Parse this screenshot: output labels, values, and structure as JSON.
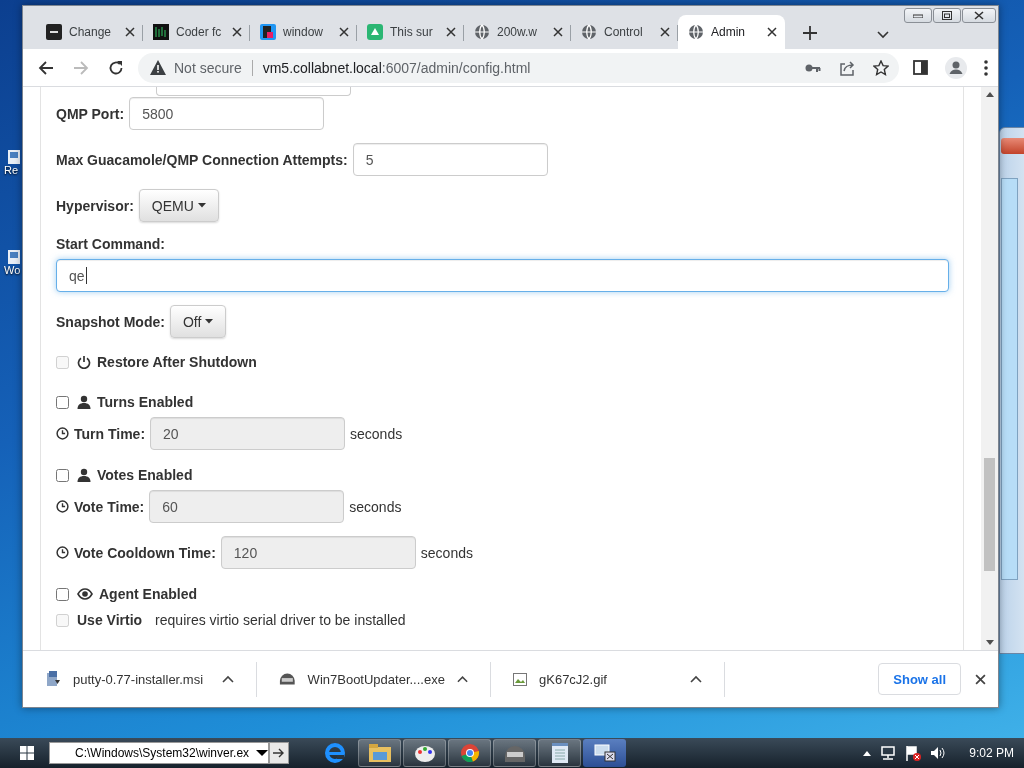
{
  "desktop": {
    "icon_labels": [
      "Re",
      "Wo"
    ]
  },
  "browser": {
    "tabs": [
      {
        "label": "Change",
        "selected": false
      },
      {
        "label": "Coder fc",
        "selected": false
      },
      {
        "label": "window",
        "selected": false
      },
      {
        "label": "This sur",
        "selected": false
      },
      {
        "label": "200w.w",
        "selected": false
      },
      {
        "label": "Control",
        "selected": false
      },
      {
        "label": "Admin",
        "selected": true
      }
    ],
    "address": {
      "security": "Not secure",
      "host": "vm5.collabnet.local",
      "path": ":6007/admin/config.html"
    }
  },
  "form": {
    "rows": [
      {
        "kind": "text",
        "label": "QMP Port:",
        "value": "5800",
        "disabled": false
      },
      {
        "kind": "text",
        "label": "Max Guacamole/QMP Connection Attempts:",
        "value": "5",
        "disabled": false
      },
      {
        "kind": "dropdown",
        "label": "Hypervisor:",
        "value": "QEMU"
      },
      {
        "kind": "command",
        "label": "Start Command:",
        "value": "qe",
        "focused": true
      },
      {
        "kind": "dropdown",
        "label": "Snapshot Mode:",
        "value": "Off"
      },
      {
        "kind": "checkbox",
        "label": "Restore After Shutdown",
        "checked": false,
        "disabled": true
      },
      {
        "kind": "checkbox",
        "label": "Turns Enabled",
        "checked": false,
        "disabled": false
      },
      {
        "kind": "time",
        "label": "Turn Time:",
        "value": "20",
        "unit": "seconds",
        "disabled": true
      },
      {
        "kind": "checkbox",
        "label": "Votes Enabled",
        "checked": false,
        "disabled": false
      },
      {
        "kind": "time",
        "label": "Vote Time:",
        "value": "60",
        "unit": "seconds",
        "disabled": true
      },
      {
        "kind": "time",
        "label": "Vote Cooldown Time:",
        "value": "120",
        "unit": "seconds",
        "disabled": true
      },
      {
        "kind": "checkbox",
        "label": "Agent Enabled",
        "checked": false,
        "disabled": false
      },
      {
        "kind": "checkbox",
        "label": "Use Virtio",
        "note": "requires virtio serial driver to be installed",
        "checked": false,
        "disabled": true
      }
    ]
  },
  "downloads": {
    "items": [
      {
        "name": "putty-0.77-installer.msi"
      },
      {
        "name": "Win7BootUpdater....exe"
      },
      {
        "name": "gK67cJ2.gif"
      }
    ],
    "show_all": "Show all"
  },
  "taskbar": {
    "run_box": "C:\\Windows\\System32\\winver.ex",
    "clock": "9:02 PM"
  }
}
